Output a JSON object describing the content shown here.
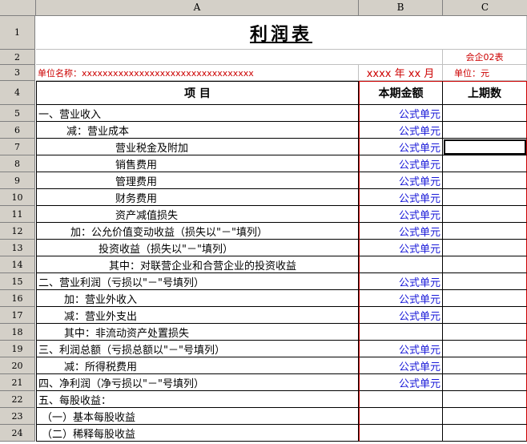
{
  "columns": [
    "A",
    "B",
    "C"
  ],
  "title": "利润表",
  "form_code": "会企02表",
  "unit_name": "单位名称：xxxxxxxxxxxxxxxxxxxxxxxxxxxxxxxxx",
  "period": "xxxx 年 xx 月",
  "currency_unit": "单位：元",
  "header": {
    "item": "项          目",
    "current": "本期金额",
    "previous": "上期数"
  },
  "formula_label": "公式单元",
  "rows": [
    {
      "no": "1"
    },
    {
      "no": "2"
    },
    {
      "no": "3"
    },
    {
      "no": "4"
    },
    {
      "no": "5",
      "label": "一、营业收入",
      "indent": 0,
      "formula": true
    },
    {
      "no": "6",
      "label": "减：营业成本",
      "indent": 35,
      "formula": true
    },
    {
      "no": "7",
      "label": "营业税金及附加",
      "indent": 96,
      "formula": true
    },
    {
      "no": "8",
      "label": "销售费用",
      "indent": 96,
      "formula": true
    },
    {
      "no": "9",
      "label": "管理费用",
      "indent": 96,
      "formula": true
    },
    {
      "no": "10",
      "label": "财务费用",
      "indent": 96,
      "formula": true
    },
    {
      "no": "11",
      "label": "资产减值损失",
      "indent": 96,
      "formula": true
    },
    {
      "no": "12",
      "label": "加：公允价值变动收益（损失以\"－\"填列）",
      "indent": 40,
      "formula": true
    },
    {
      "no": "13",
      "label": "投资收益（损失以\"－\"填列）",
      "indent": 75,
      "formula": true
    },
    {
      "no": "14",
      "label": "其中：对联营企业和合营企业的投资收益",
      "indent": 88,
      "formula": false
    },
    {
      "no": "15",
      "label": "二、营业利润（亏损以\"－\"号填列）",
      "indent": 0,
      "formula": true
    },
    {
      "no": "16",
      "label": "加：营业外收入",
      "indent": 32,
      "formula": true
    },
    {
      "no": "17",
      "label": "减：营业外支出",
      "indent": 32,
      "formula": true
    },
    {
      "no": "18",
      "label": "其中：非流动资产处置损失",
      "indent": 32,
      "formula": false
    },
    {
      "no": "19",
      "label": "三、利润总额（亏损总额以\"－\"号填列）",
      "indent": 0,
      "formula": true
    },
    {
      "no": "20",
      "label": "减：所得税费用",
      "indent": 32,
      "formula": true
    },
    {
      "no": "21",
      "label": "四、净利润（净亏损以\"－\"号填列）",
      "indent": 0,
      "formula": true
    },
    {
      "no": "22",
      "label": "五、每股收益：",
      "indent": 0,
      "formula": false
    },
    {
      "no": "23",
      "label": "（一）基本每股收益",
      "indent": 4,
      "formula": false
    },
    {
      "no": "24",
      "label": "（二）稀释每股收益",
      "indent": 4,
      "formula": false
    }
  ]
}
